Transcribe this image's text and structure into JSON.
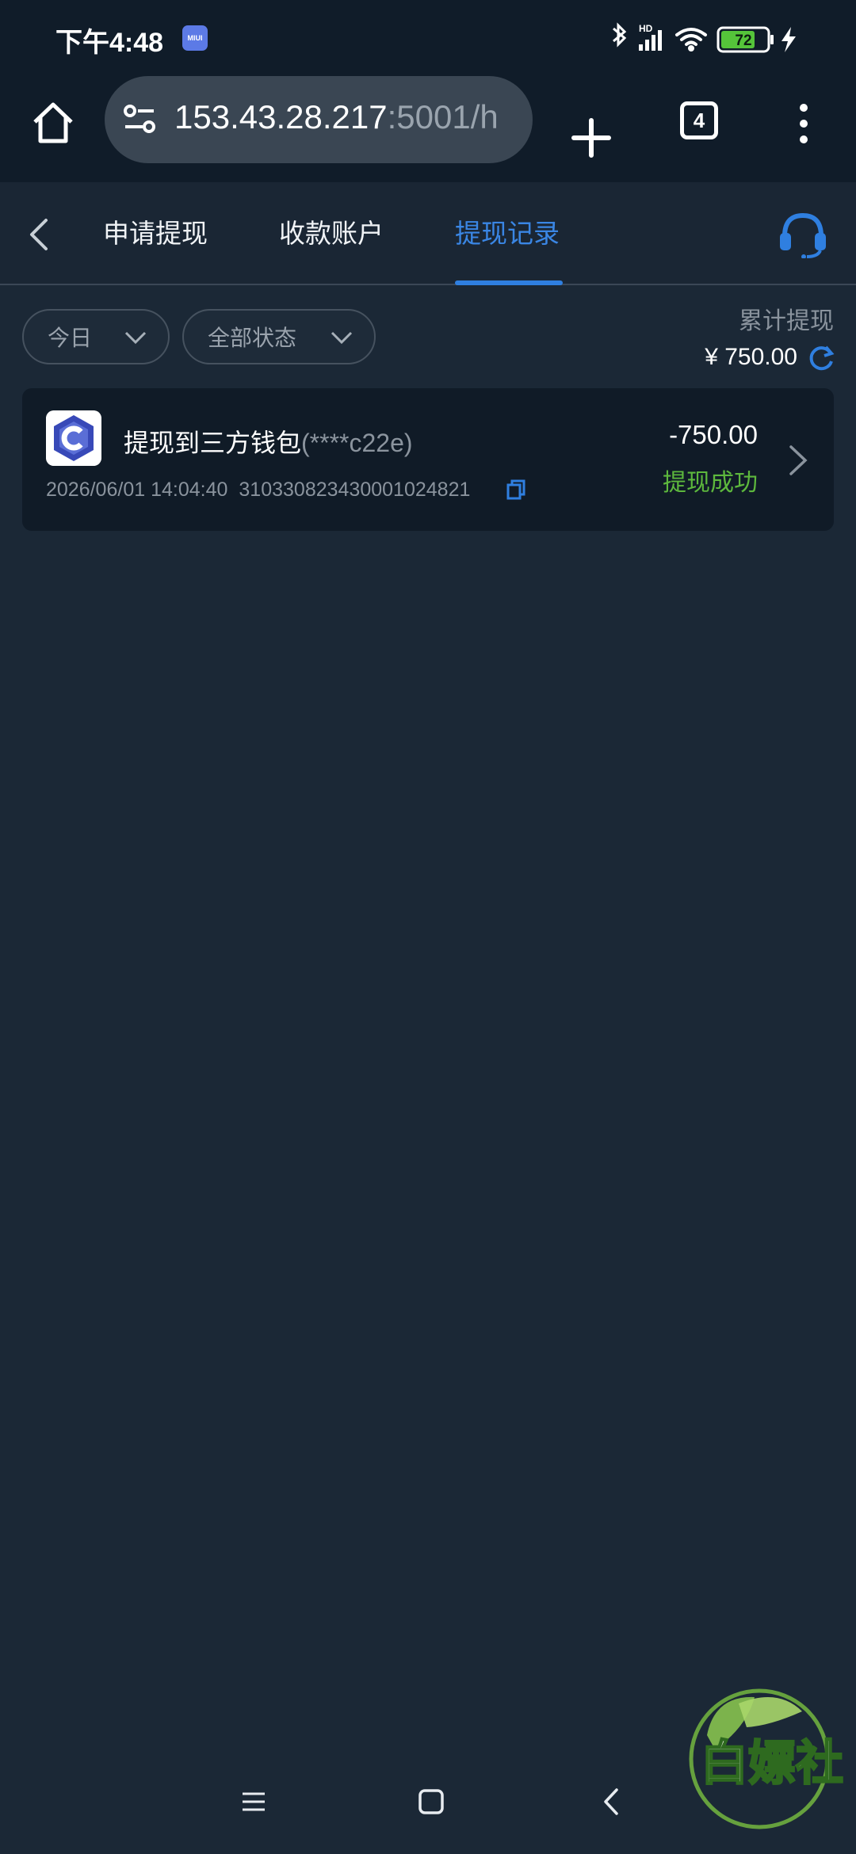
{
  "status_bar": {
    "time": "下午4:48",
    "miui_badge": "MIUI",
    "network_label": "HD",
    "battery": "72",
    "icons": [
      "bluetooth-icon",
      "signal-icon",
      "wifi-icon",
      "battery-icon",
      "charging-icon"
    ]
  },
  "browser": {
    "url_host": "153.43.28.217",
    "url_rest": ":5001/h",
    "tab_count": "4",
    "icons": [
      "home-icon",
      "site-settings-icon",
      "plus-icon",
      "more-vert-icon"
    ]
  },
  "nav": {
    "tabs": [
      {
        "label": "申请提现",
        "active": false
      },
      {
        "label": "收款账户",
        "active": false
      },
      {
        "label": "提现记录",
        "active": true
      }
    ],
    "icons": [
      "back-arrow-icon",
      "headset-support-icon"
    ],
    "accent_color": "#2f7fe0"
  },
  "filters": {
    "date": "今日",
    "status": "全部状态"
  },
  "summary": {
    "label": "累计提现",
    "amount": "¥ 750.00"
  },
  "records": [
    {
      "title": "提现到三方钱包",
      "account": "(****c22e)",
      "datetime": "2026/06/01 14:04:40",
      "txid": "31033082343000102482‍1",
      "amount": "-750.00",
      "status": "提现成功",
      "status_color": "#5db83d"
    }
  ],
  "watermark": {
    "text": "白嫖社"
  },
  "system_nav": {
    "icons": [
      "menu-icon",
      "home-square-icon",
      "back-icon"
    ]
  }
}
